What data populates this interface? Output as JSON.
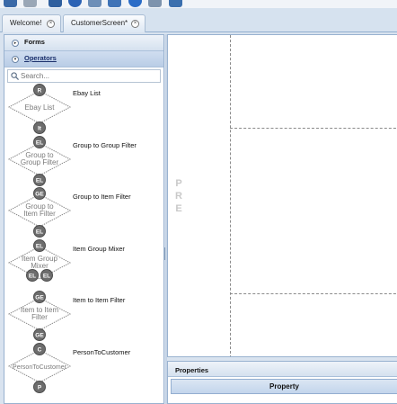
{
  "toolbar": {
    "icons": [
      "home-icon",
      "tool-icon",
      "save-icon",
      "info-icon",
      "import-icon",
      "rss-icon",
      "refresh-icon",
      "puzzle-icon",
      "export-icon"
    ]
  },
  "tabs": [
    {
      "label": "Welcome!",
      "active": false
    },
    {
      "label": "CustomerScreen*",
      "active": true
    }
  ],
  "left_panel": {
    "sections": [
      {
        "label": "Forms",
        "active": false
      },
      {
        "label": "Operators",
        "active": true
      }
    ],
    "search_placeholder": "Search...",
    "operators": [
      {
        "label": "Ebay List",
        "shape_text": [
          "Ebay List"
        ],
        "top_badge": "R",
        "bottom_badges": [
          "It"
        ]
      },
      {
        "label": "Group to Group Filter",
        "shape_text": [
          "Group to",
          "Group Filter"
        ],
        "top_badge": "EL",
        "bottom_badges": [
          "EL"
        ]
      },
      {
        "label": "Group to Item Filter",
        "shape_text": [
          "Group to",
          "Item Filter"
        ],
        "top_badge": "GE",
        "bottom_badges": [
          "EL"
        ]
      },
      {
        "label": "Item Group Mixer",
        "shape_text": [
          "Item Group",
          "Mixer"
        ],
        "top_badge": "EL",
        "bottom_badges": [
          "EL",
          "EL"
        ]
      },
      {
        "label": "Item to Item Filter",
        "shape_text": [
          "Item to Item",
          "Filter"
        ],
        "top_badge": "GE",
        "bottom_badges": [
          "GE"
        ]
      },
      {
        "label": "PersonToCustomer",
        "shape_text": [
          "PersonToCustomer"
        ],
        "top_badge": "C",
        "bottom_badges": [
          "P"
        ]
      }
    ]
  },
  "canvas": {
    "side_letters": [
      "P",
      "R",
      "E"
    ]
  },
  "properties": {
    "title": "Properties",
    "column": "Property"
  }
}
